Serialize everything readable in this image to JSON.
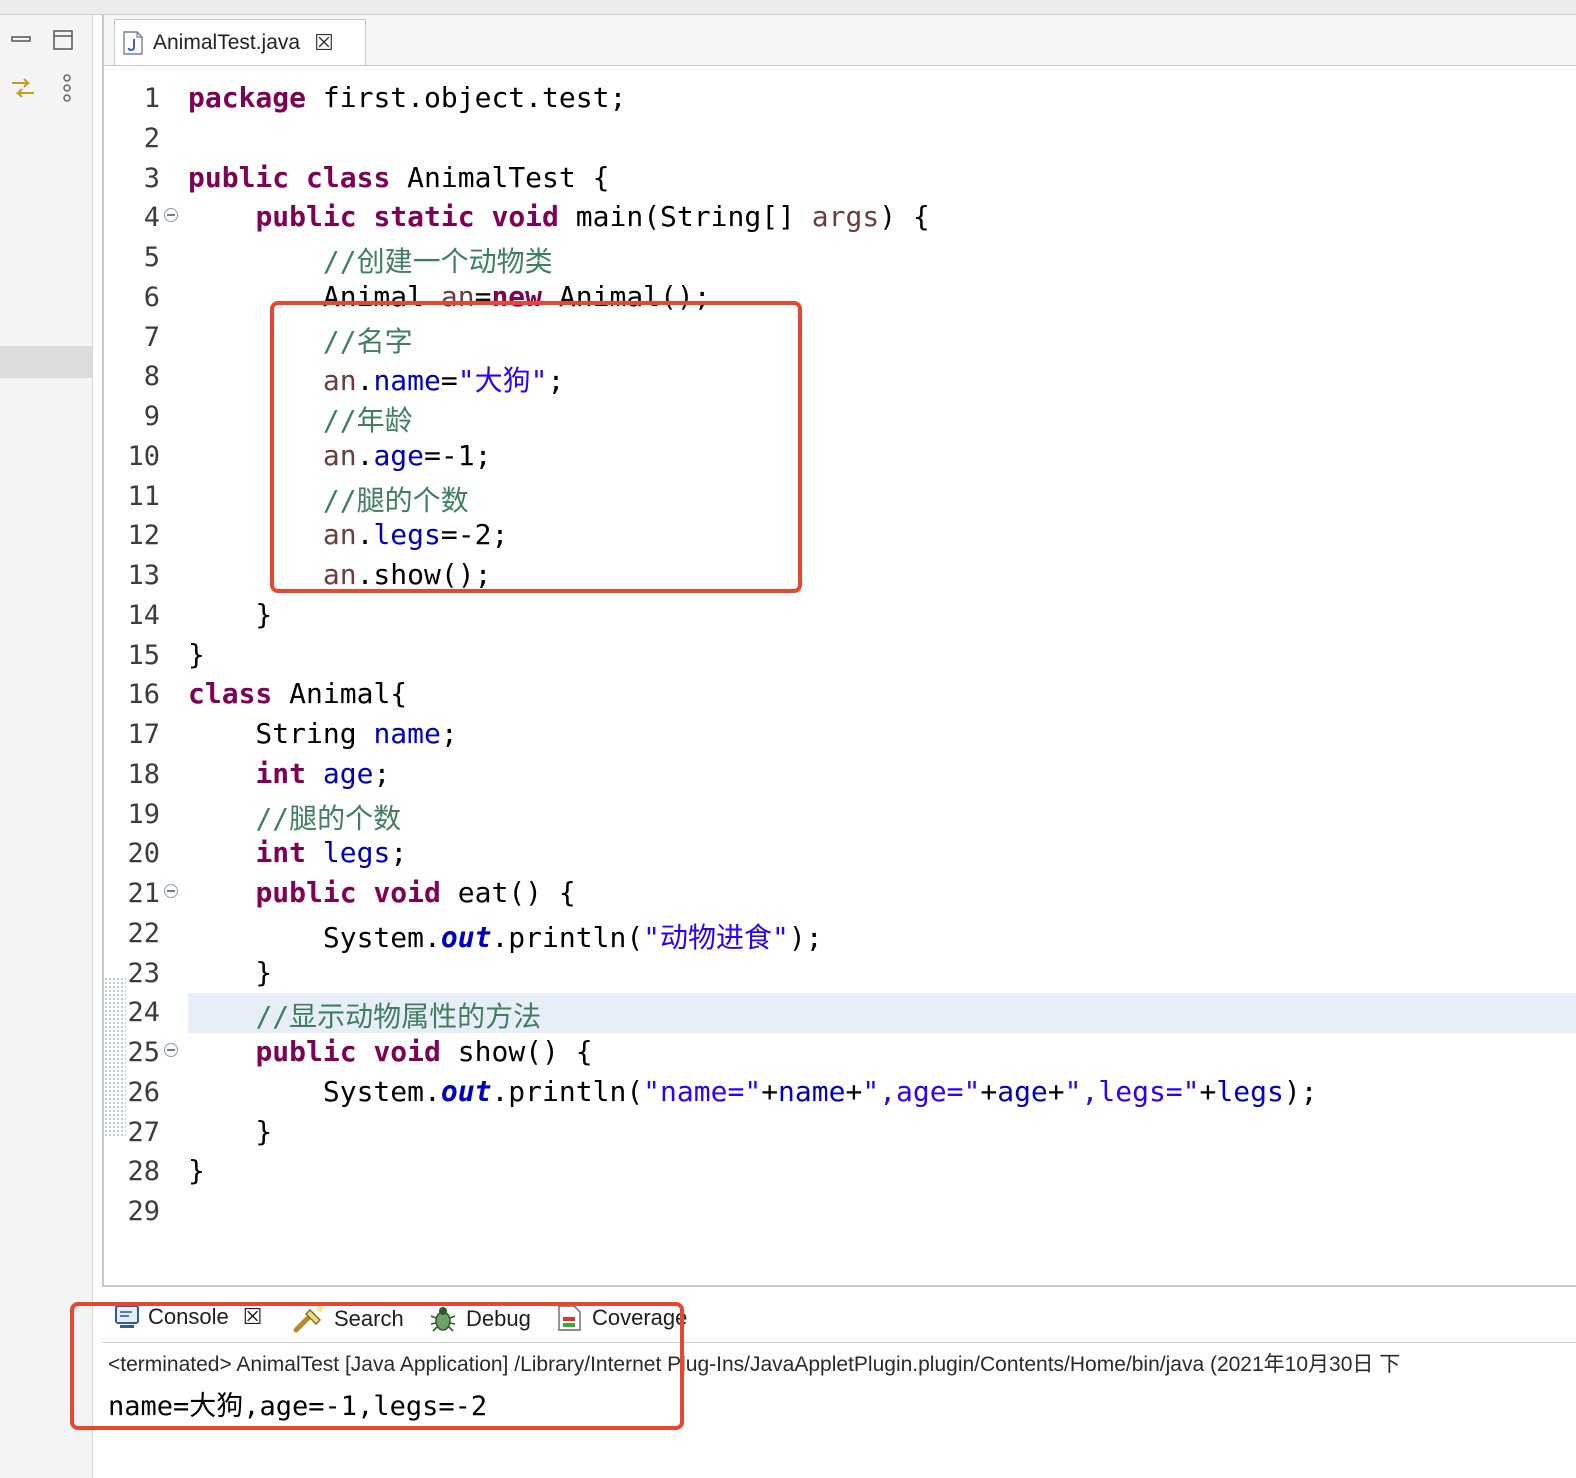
{
  "editor": {
    "tab_label": "AnimalTest.java",
    "lines": [
      {
        "n": "1",
        "html": "<span class=\"kw\">package</span> first.object.test;"
      },
      {
        "n": "2",
        "html": ""
      },
      {
        "n": "3",
        "html": "<span class=\"kw\">public</span> <span class=\"kw\">class</span> AnimalTest {"
      },
      {
        "n": "4",
        "fold": true,
        "html": "    <span class=\"kw\">public</span> <span class=\"kw\">static</span> <span class=\"kw\">void</span> main(String[] <span class=\"lv\">args</span>) {"
      },
      {
        "n": "5",
        "html": "        <span class=\"cm\">//创建一个动物类</span>"
      },
      {
        "n": "6",
        "html": "        Animal <span class=\"lv\">an</span>=<span class=\"kw\">new</span> Animal();"
      },
      {
        "n": "7",
        "html": "        <span class=\"cm\">//名字</span>"
      },
      {
        "n": "8",
        "html": "        <span class=\"lv\">an</span>.<span class=\"fd\">name</span>=<span class=\"st\">\"大狗\"</span>;"
      },
      {
        "n": "9",
        "html": "        <span class=\"cm\">//年龄</span>"
      },
      {
        "n": "10",
        "html": "        <span class=\"lv\">an</span>.<span class=\"fd\">age</span>=-1;"
      },
      {
        "n": "11",
        "html": "        <span class=\"cm\">//腿的个数</span>"
      },
      {
        "n": "12",
        "html": "        <span class=\"lv\">an</span>.<span class=\"fd\">legs</span>=-2;"
      },
      {
        "n": "13",
        "html": "        <span class=\"lv\">an</span>.show();"
      },
      {
        "n": "14",
        "html": "    }"
      },
      {
        "n": "15",
        "html": "}"
      },
      {
        "n": "16",
        "html": "<span class=\"kw\">class</span> Animal{"
      },
      {
        "n": "17",
        "html": "    String <span class=\"fd\">name</span>;"
      },
      {
        "n": "18",
        "html": "    <span class=\"kw\">int</span> <span class=\"fd\">age</span>;"
      },
      {
        "n": "19",
        "html": "    <span class=\"cm\">//腿的个数</span>"
      },
      {
        "n": "20",
        "html": "    <span class=\"kw\">int</span> <span class=\"fd\">legs</span>;"
      },
      {
        "n": "21",
        "fold": true,
        "html": "    <span class=\"kw\">public</span> <span class=\"kw\">void</span> eat() {"
      },
      {
        "n": "22",
        "html": "        System.<span class=\"st-it\">out</span>.println(<span class=\"st\">\"动物进食\"</span>);"
      },
      {
        "n": "23",
        "html": "    }"
      },
      {
        "n": "24",
        "highlight": true,
        "html": "    <span class=\"cm\">//显示动物属性的方法</span>"
      },
      {
        "n": "25",
        "fold": true,
        "html": "    <span class=\"kw\">public</span> <span class=\"kw\">void</span> show() {"
      },
      {
        "n": "26",
        "html": "        System.<span class=\"st-it\">out</span>.println(<span class=\"st\">\"name=\"</span>+<span class=\"fd\">name</span>+<span class=\"st\">\",age=\"</span>+<span class=\"fd\">age</span>+<span class=\"st\">\",legs=\"</span>+<span class=\"fd\">legs</span>);"
      },
      {
        "n": "27",
        "html": "    }"
      },
      {
        "n": "28",
        "html": "}"
      },
      {
        "n": "29",
        "html": ""
      }
    ]
  },
  "console": {
    "tabs": {
      "console": "Console",
      "search": "Search",
      "debug": "Debug",
      "coverage": "Coverage"
    },
    "path": "<terminated> AnimalTest [Java Application] /Library/Internet Plug-Ins/JavaAppletPlugin.plugin/Contents/Home/bin/java  (2021年10月30日 下",
    "output": "name=大狗,age=-1,legs=-2"
  },
  "colors": {
    "keyword": "#7f0055",
    "comment": "#3f7f5f",
    "string": "#2a00ff",
    "field": "#0000c0",
    "annotation_box": "#e8462f"
  }
}
